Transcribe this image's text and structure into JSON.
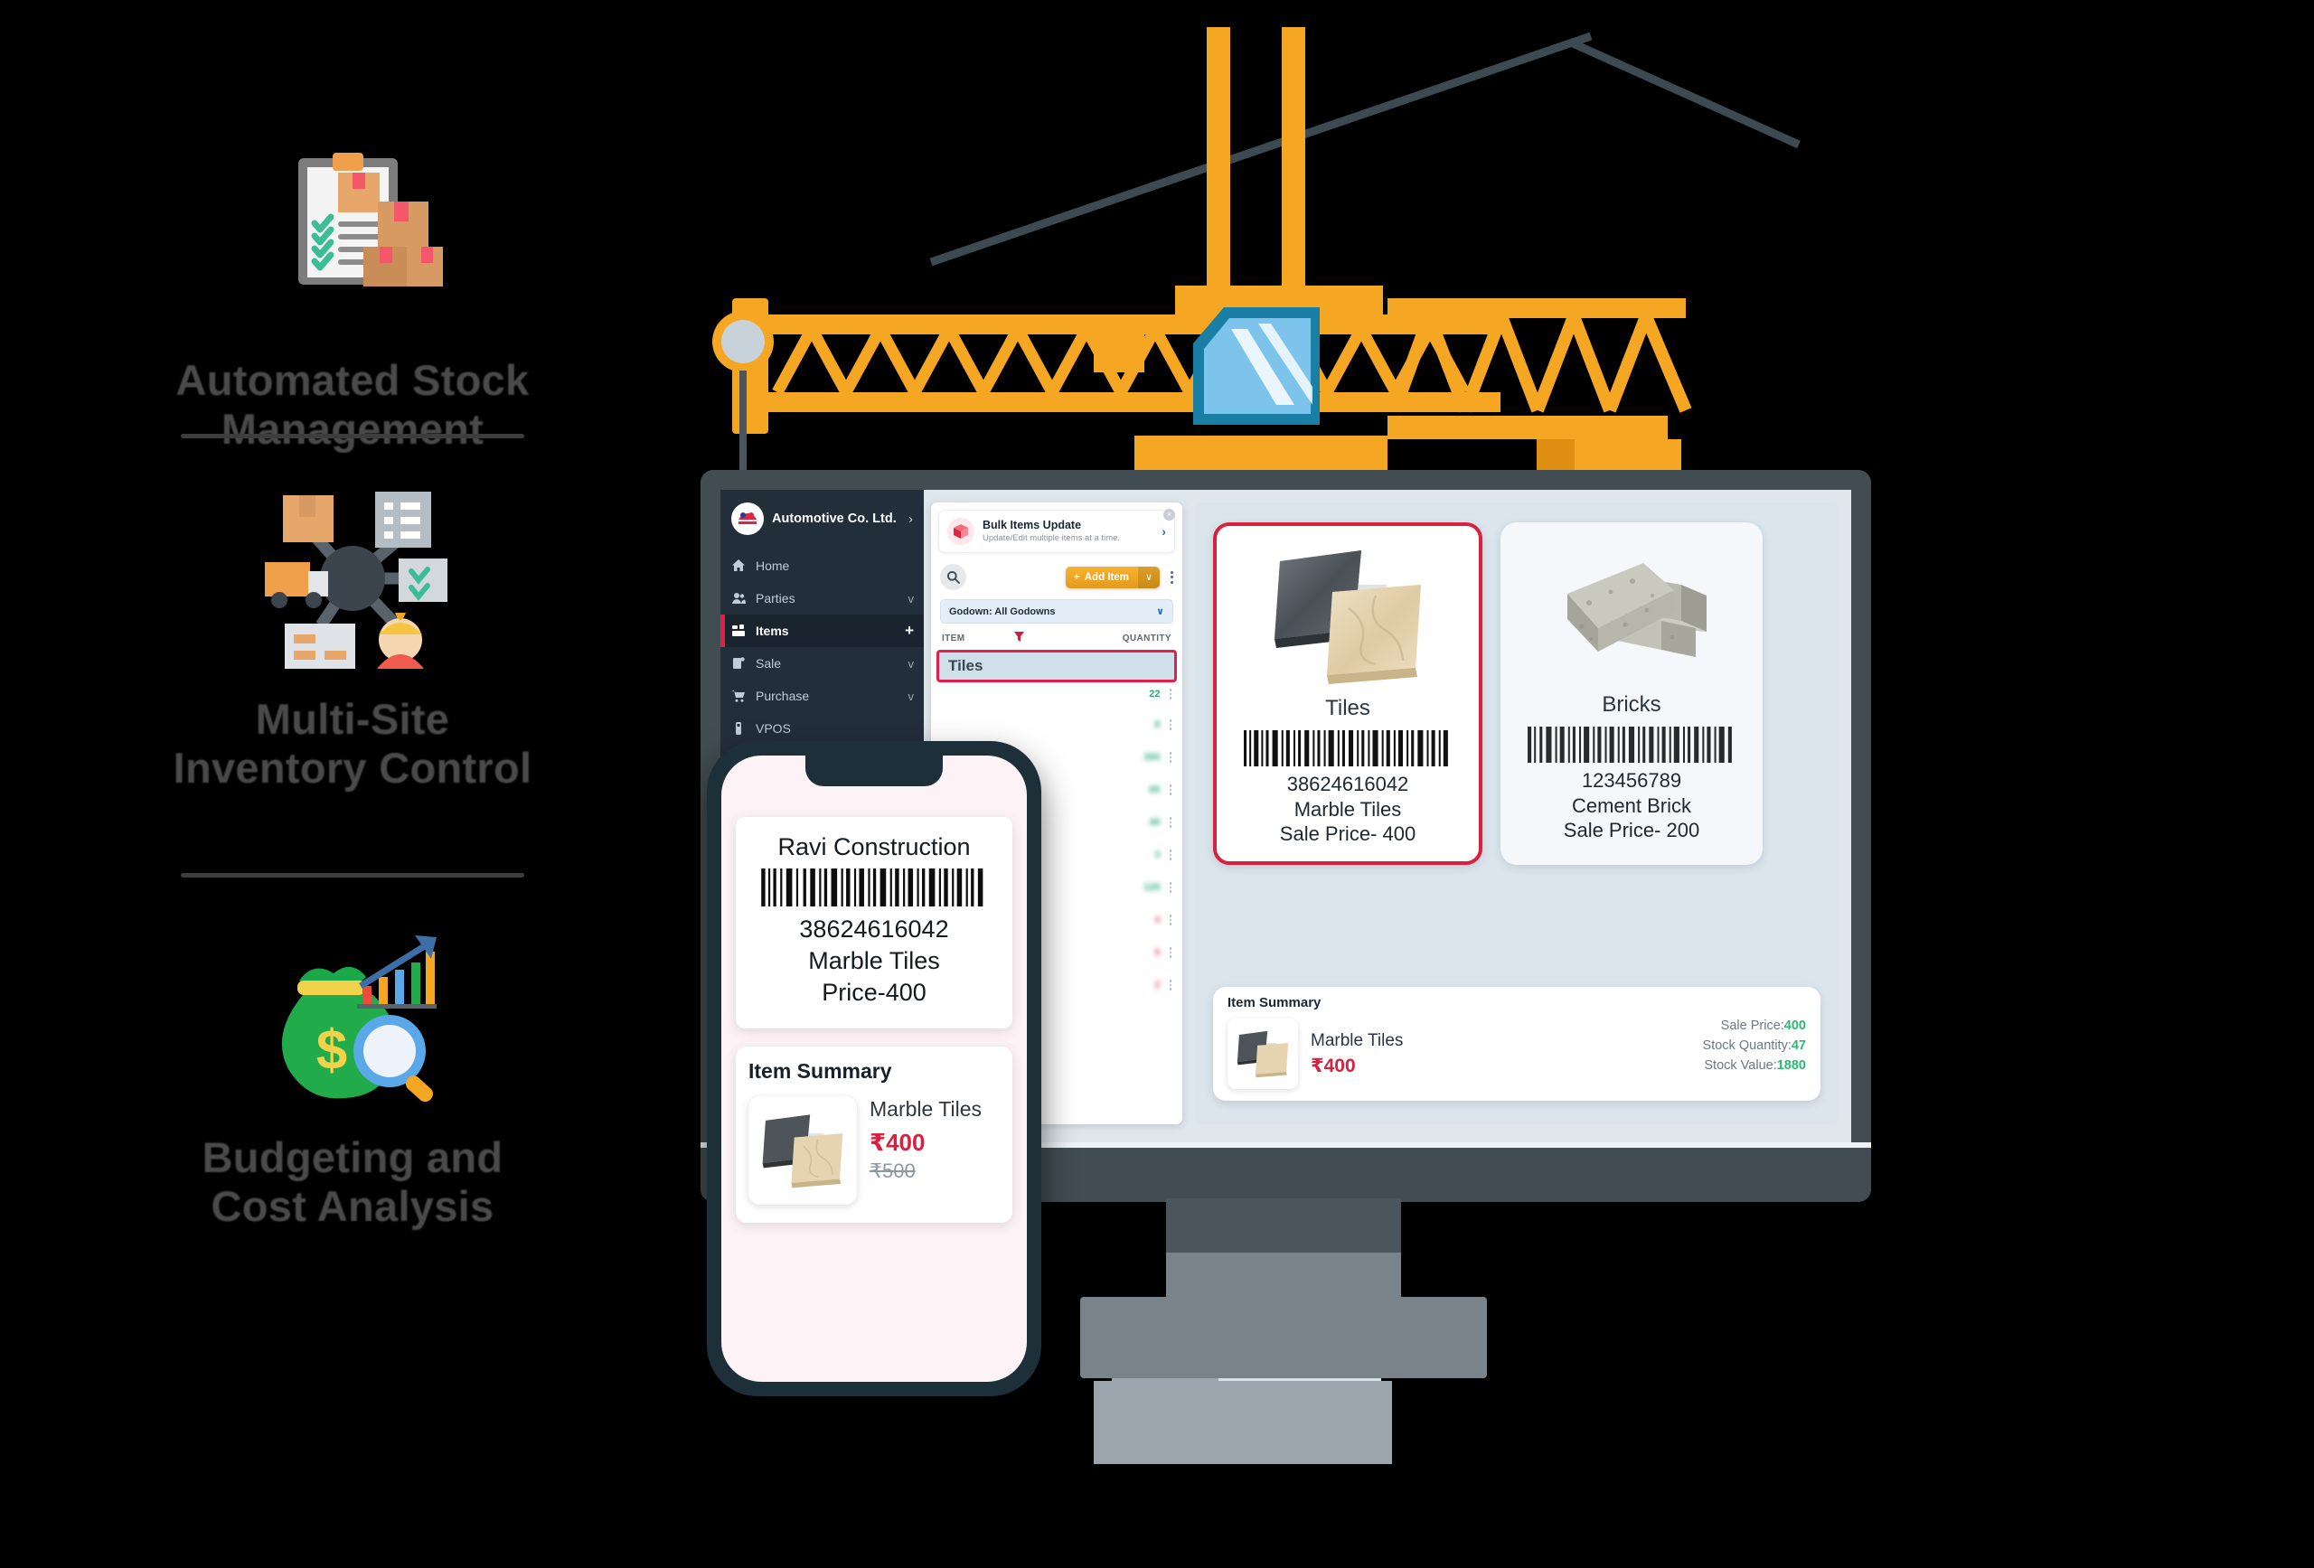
{
  "features": [
    {
      "icon": "clipboard-checklist-boxes-icon",
      "label": "Automated Stock\nManagement"
    },
    {
      "icon": "multi-site-network-icon",
      "label": "Multi-Site\nInventory Control"
    },
    {
      "icon": "money-bag-chart-magnifier-icon",
      "label": "Budgeting and\nCost Analysis"
    }
  ],
  "desktop_app": {
    "sidebar": {
      "company": "Automotive Co. Ltd.",
      "items": [
        {
          "label": "Home",
          "icon": "home-icon",
          "tail": "",
          "active": false
        },
        {
          "label": "Parties",
          "icon": "users-icon",
          "tail": "v",
          "active": false
        },
        {
          "label": "Items",
          "icon": "boxes-icon",
          "tail": "+",
          "active": true
        },
        {
          "label": "Sale",
          "icon": "receipt-icon",
          "tail": "v",
          "active": false
        },
        {
          "label": "Purchase",
          "icon": "cart-icon",
          "tail": "v",
          "active": false
        },
        {
          "label": "VPOS",
          "icon": "terminal-icon",
          "tail": "",
          "active": false
        }
      ]
    },
    "banner": {
      "title": "Bulk Items Update",
      "subtitle": "Update/Edit multiple items at a time.",
      "chevron": "›",
      "close": "×"
    },
    "toolbar": {
      "search_icon": "search-icon",
      "add_item_label": "Add Item",
      "add_item_plus": "+",
      "add_item_caret": "∨",
      "kebab": "more-options-icon"
    },
    "godown_filter": {
      "label": "Godown: All Godowns",
      "caret": "∨"
    },
    "table": {
      "col_item": "ITEM",
      "col_quantity": "QUANTITY",
      "filter_icon": "filter-icon",
      "selected_row": "Tiles",
      "quantities": [
        "22",
        "8",
        "300",
        "65",
        "40",
        "3",
        "120",
        "4",
        "6",
        "2"
      ]
    },
    "product_cards": [
      {
        "image": "marble-tiles-image",
        "name": "Tiles",
        "barcode": "38624616042",
        "desc": "Marble Tiles",
        "price_line": "Sale Price- 400",
        "selected": true
      },
      {
        "image": "cement-bricks-image",
        "name": "Bricks",
        "barcode": "123456789",
        "desc": "Cement Brick",
        "price_line": "Sale Price- 200",
        "selected": false
      }
    ],
    "item_summary": {
      "title": "Item Summary",
      "thumb": "marble-tiles-thumb",
      "name": "Marble Tiles",
      "price": "₹400",
      "stats": [
        {
          "label": "Sale Price:",
          "value": "400"
        },
        {
          "label": "Stock Quantity:",
          "value": "47"
        },
        {
          "label": "Stock Value:",
          "value": "1880"
        }
      ]
    }
  },
  "phone_app": {
    "label_card": {
      "title": "Ravi Construction",
      "barcode": "38624616042",
      "desc": "Marble Tiles",
      "price_line": "Price-400"
    },
    "item_summary": {
      "title": "Item Summary",
      "thumb": "marble-tiles-thumb",
      "name": "Marble Tiles",
      "price": "₹400",
      "old_price": "₹500"
    }
  },
  "scene": {
    "crane": "tower-crane-illustration",
    "monitor": "desktop-monitor-illustration",
    "phone": "smartphone-illustration"
  },
  "colors": {
    "background": "#000000",
    "accent_red": "#d8203f",
    "accent_orange": "#f5a623",
    "sidebar": "#222e3a",
    "screen_bg": "#dbe5ec",
    "green": "#2cb978"
  }
}
